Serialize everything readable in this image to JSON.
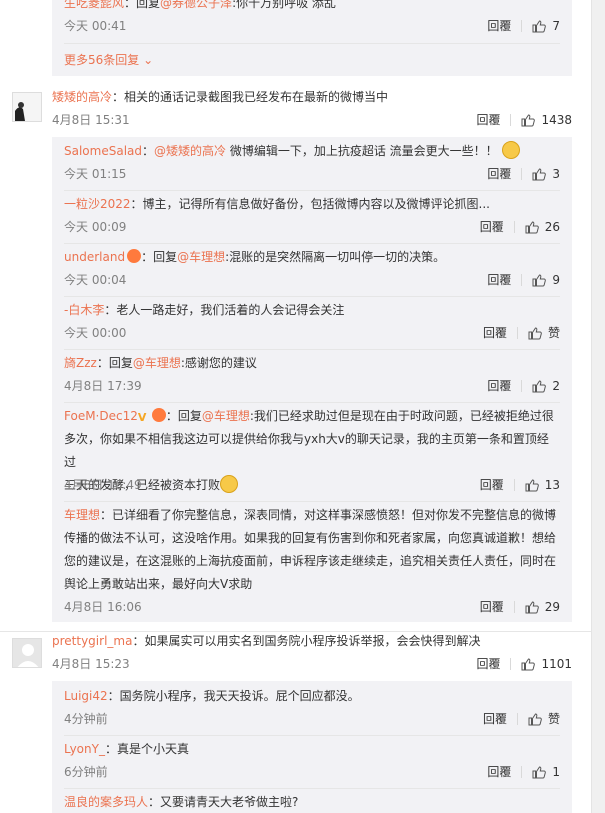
{
  "common": {
    "reply": "回覆"
  },
  "top": {
    "user": "生吃菱髭风",
    "sep": "：",
    "reply_prefix": "回复",
    "mention": "@券德公子泽",
    "text": ":你千万别呼吸 添乱",
    "time": "今天 00:41",
    "likes": "7",
    "more": "更多56条回复 ⌄"
  },
  "c1": {
    "user": "矮矮的高冷",
    "text": "：相关的通话记录截图我已经发布在最新的微博当中",
    "time": "4月8日 15:31",
    "likes": "1438",
    "replies": [
      {
        "user": "SalomeSalad",
        "sep": "：",
        "mention": "@矮矮的高冷",
        "text": " 微博编辑一下，加上抗疫超话 流量会更大一些！！",
        "time": "今天 01:15",
        "likes": "3"
      },
      {
        "user": "一粒沙2022",
        "text": "：博主，记得所有信息做好备份，包括微博内容以及微博评论抓图...",
        "time": "今天 00:09",
        "likes": "26"
      },
      {
        "user": "underland",
        "sep": "：回复",
        "mention": "@车理想",
        "text": ":混账的是突然隔离一切叫停一切的决策。",
        "time": "今天 00:04",
        "likes": "9"
      },
      {
        "user": "-白木李",
        "text": "：老人一路走好，我们活着的人会记得会关注",
        "time": "今天 00:00",
        "likes": "赞"
      },
      {
        "user": "旖Zzz",
        "sep": "：回复",
        "mention": "@车理想",
        "text": ":感谢您的建议",
        "time": "4月8日 17:39",
        "likes": "2"
      },
      {
        "user": "FoeM·Dec12",
        "sep": "：回复",
        "mention": "@车理想",
        "line1": ":我们已经求助过但是现在由于时政问题，已经被拒绝过很",
        "line2": "多次，你如果不相信我这边可以提供给你我与yxh大v的聊天记录，我的主页第一条和置顶经过",
        "line3": "三天的发酵，已经被资本打败",
        "time": "4月8日 16:49",
        "likes": "13"
      },
      {
        "user": "车理想",
        "line1": "：已详细看了你完整信息，深表同情，对这样事深感愤怒！但对你发不完整信息的微博",
        "line2": "传播的做法不认可，这没啥作用。如果我的回复有伤害到你和死者家属，向您真诚道歉！想给",
        "line3": "您的建议是，在这混账的上海抗疫面前，申诉程序该走继续走，追究相关责任人责任，同时在",
        "line4": "舆论上勇敢站出来，最好向大V求助",
        "time": "4月8日 16:06",
        "likes": "29"
      }
    ]
  },
  "c2": {
    "user": "prettygirl_ma",
    "text": "：如果属实可以用实名到国务院小程序投诉举报，会会快得到解决",
    "time": "4月8日 15:23",
    "likes": "1101",
    "replies": [
      {
        "user": "Luigi42",
        "text": "：国务院小程序，我天天投诉。屁个回应都没。",
        "time": "4分钟前",
        "likes": "赞"
      },
      {
        "user": "LyonY_",
        "text": "：真是个小天真",
        "time": "6分钟前",
        "likes": "1"
      },
      {
        "user": "温良的案多玛人",
        "text": "：又要请青天大老爷做主啦?"
      }
    ]
  }
}
